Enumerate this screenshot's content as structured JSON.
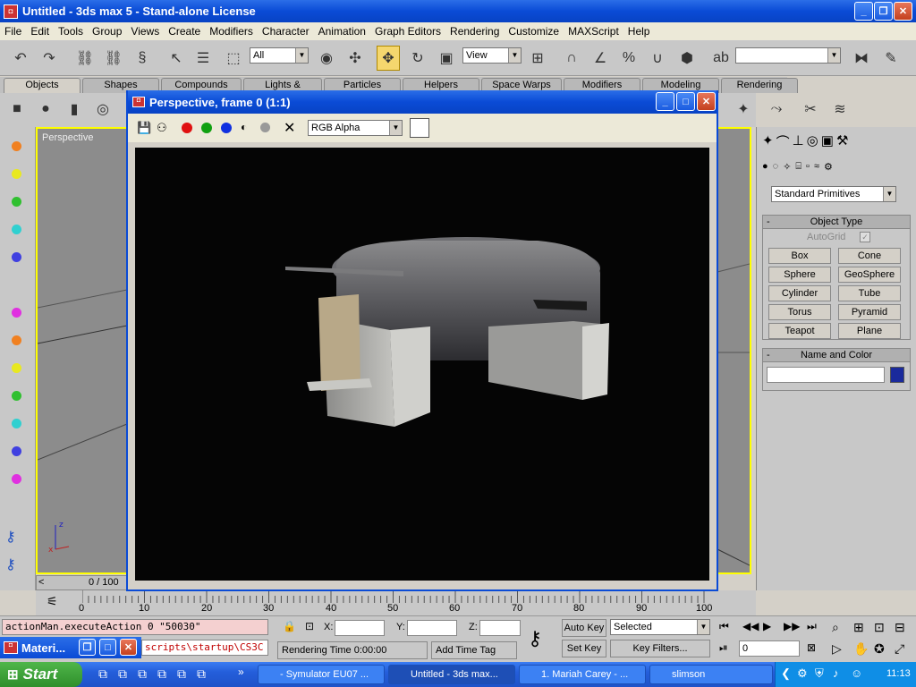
{
  "window": {
    "title": "Untitled - 3ds max 5 - Stand-alone License"
  },
  "menu": [
    "File",
    "Edit",
    "Tools",
    "Group",
    "Views",
    "Create",
    "Modifiers",
    "Character",
    "Animation",
    "Graph Editors",
    "Rendering",
    "Customize",
    "MAXScript",
    "Help"
  ],
  "toolbar": {
    "selection_filter": "All",
    "ref_coord": "View",
    "named_sel": ""
  },
  "tabs": [
    "Objects",
    "Shapes",
    "Compounds",
    "Lights & Cameras",
    "Particles",
    "Helpers",
    "Space Warps",
    "Modifiers",
    "Modeling",
    "Rendering"
  ],
  "viewport": {
    "label": "Perspective",
    "frame_counter": "0 / 100"
  },
  "render_window": {
    "title": "Perspective, frame 0 (1:1)",
    "channel": "RGB Alpha"
  },
  "command_panel": {
    "category": "Standard Primitives",
    "object_type_title": "Object Type",
    "autogrid": "AutoGrid",
    "primitives": [
      "Box",
      "Cone",
      "Sphere",
      "GeoSphere",
      "Cylinder",
      "Tube",
      "Torus",
      "Pyramid",
      "Teapot",
      "Plane"
    ],
    "name_color_title": "Name and Color",
    "name_value": "",
    "swatch_color": "#1a2a9c"
  },
  "ruler": {
    "ticks": [
      "0",
      "10",
      "20",
      "30",
      "40",
      "50",
      "60",
      "70",
      "80",
      "90",
      "100"
    ]
  },
  "status": {
    "listener_line1": "actionMan.executeAction 0 \"50030\"",
    "listener_line2": "scripts\\startup\\CS3C",
    "x_label": "X:",
    "y_label": "Y:",
    "z_label": "Z:",
    "rendering_time": "Rendering Time  0:00:00",
    "add_time_tag": "Add Time Tag",
    "auto_key": "Auto Key",
    "set_key": "Set Key",
    "selected": "Selected",
    "key_filters": "Key Filters...",
    "frame_value": "0"
  },
  "material_window": {
    "title": "Materi..."
  },
  "taskbar": {
    "start": "Start",
    "tasks": [
      "- Symulator EU07 ...",
      "Untitled - 3ds max...",
      "1. Mariah Carey - ...",
      "slimson"
    ],
    "clock": "11:13"
  }
}
